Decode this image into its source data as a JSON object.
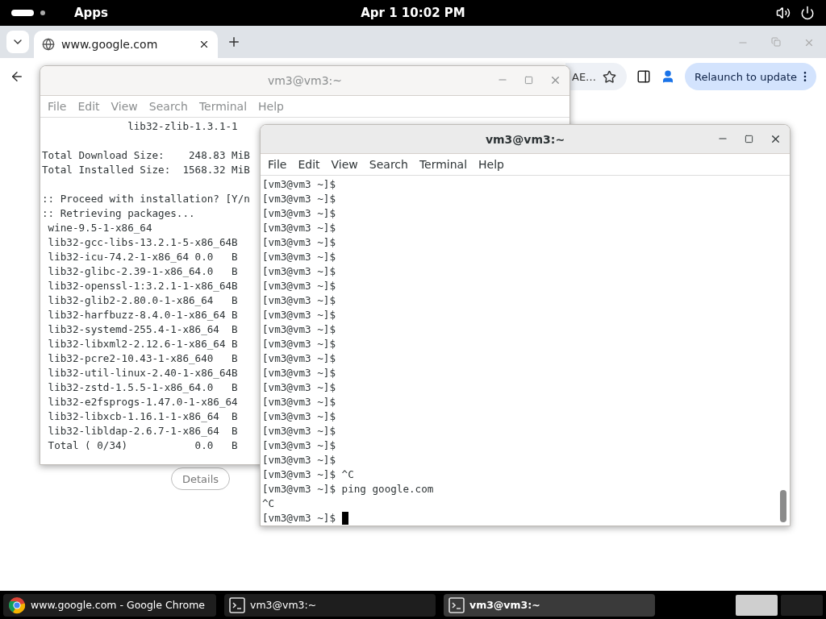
{
  "top_bar": {
    "apps_label": "Apps",
    "clock": "Apr 1  10:02 PM"
  },
  "browser": {
    "tab": {
      "title": "www.google.com",
      "selected": true
    },
    "address_fragment": "AE…",
    "relaunch_button": "Relaunch to update",
    "details_button": "Details"
  },
  "windows": [
    {
      "title": "vm3@vm3:~",
      "focused": false,
      "menu": [
        "File",
        "Edit",
        "View",
        "Search",
        "Terminal",
        "Help"
      ],
      "cursor_visible": false,
      "blocks": [
        [
          "              lib32-zlib-1.3.1-1"
        ],
        [
          "Total Download Size:    248.83 MiB",
          "Total Installed Size:  1568.32 MiB"
        ],
        [
          ":: Proceed with installation? [Y/n",
          ":: Retrieving packages...",
          " wine-9.5-1-x86_64",
          " lib32-gcc-libs-13.2.1-5-x86_64B",
          " lib32-icu-74.2-1-x86_64 0.0   B",
          " lib32-glibc-2.39-1-x86_64.0   B",
          " lib32-openssl-1:3.2.1-1-x86_64B",
          " lib32-glib2-2.80.0-1-x86_64   B",
          " lib32-harfbuzz-8.4.0-1-x86_64 B",
          " lib32-systemd-255.4-1-x86_64  B",
          " lib32-libxml2-2.12.6-1-x86_64 B",
          " lib32-pcre2-10.43-1-x86_640   B",
          " lib32-util-linux-2.40-1-x86_64B",
          " lib32-zstd-1.5.5-1-x86_64.0   B",
          " lib32-e2fsprogs-1.47.0-1-x86_64",
          " lib32-libxcb-1.16.1-1-x86_64  B",
          " lib32-libldap-2.6.7-1-x86_64  B",
          " Total ( 0/34)           0.0   B"
        ]
      ]
    },
    {
      "title": "vm3@vm3:~",
      "focused": true,
      "menu": [
        "File",
        "Edit",
        "View",
        "Search",
        "Terminal",
        "Help"
      ],
      "cursor_visible": true,
      "blocks": [
        [
          "[vm3@vm3 ~]$",
          "[vm3@vm3 ~]$",
          "[vm3@vm3 ~]$",
          "[vm3@vm3 ~]$",
          "[vm3@vm3 ~]$",
          "[vm3@vm3 ~]$",
          "[vm3@vm3 ~]$",
          "[vm3@vm3 ~]$",
          "[vm3@vm3 ~]$",
          "[vm3@vm3 ~]$",
          "[vm3@vm3 ~]$",
          "[vm3@vm3 ~]$",
          "[vm3@vm3 ~]$",
          "[vm3@vm3 ~]$",
          "[vm3@vm3 ~]$",
          "[vm3@vm3 ~]$",
          "[vm3@vm3 ~]$",
          "[vm3@vm3 ~]$",
          "[vm3@vm3 ~]$",
          "[vm3@vm3 ~]$",
          "[vm3@vm3 ~]$ ^C",
          "[vm3@vm3 ~]$ ping google.com",
          "^C",
          "[vm3@vm3 ~]$ "
        ]
      ]
    }
  ],
  "taskbar": {
    "items": [
      {
        "kind": "chrome",
        "label": "www.google.com - Google Chrome",
        "selected": false
      },
      {
        "kind": "terminal",
        "label": "vm3@vm3:~",
        "selected": false
      },
      {
        "kind": "terminal",
        "label": "vm3@vm3:~",
        "selected": true
      }
    ],
    "workspaces": [
      {
        "selected": true
      },
      {
        "selected": false
      }
    ]
  }
}
